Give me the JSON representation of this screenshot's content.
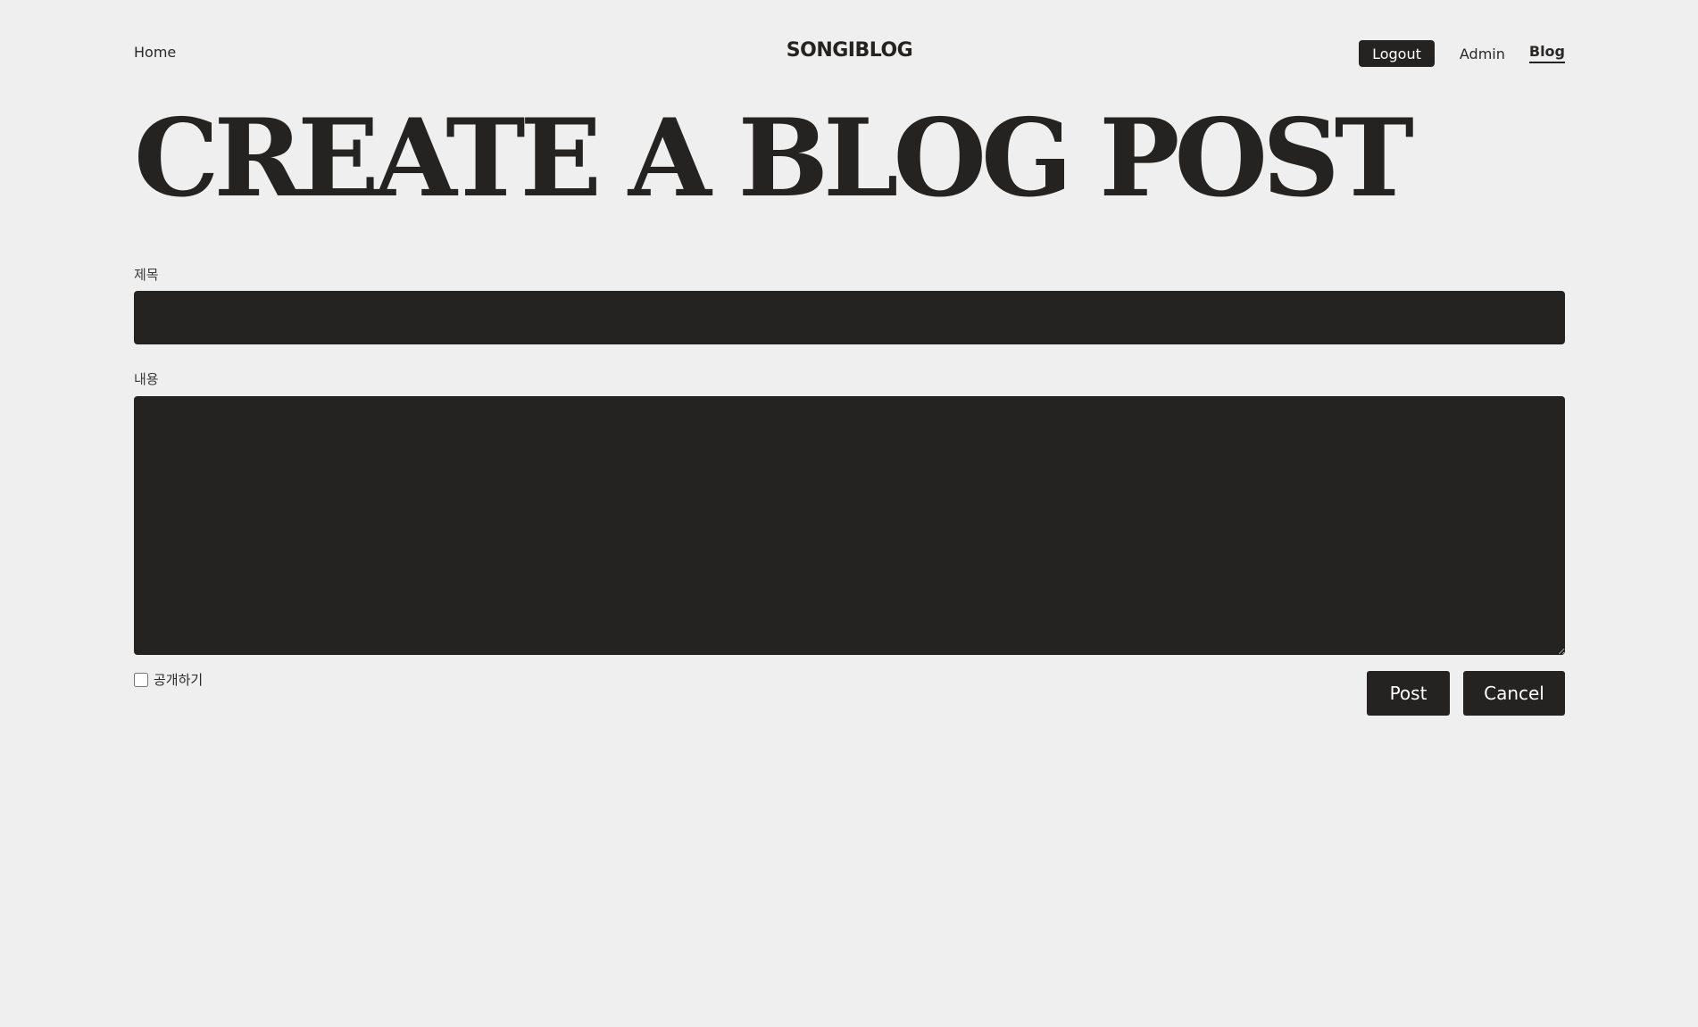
{
  "header": {
    "home_link": "Home",
    "brand": "SONGIBLOG",
    "logout_label": "Logout",
    "admin_link": "Admin",
    "blog_link": "Blog"
  },
  "page": {
    "title": "CREATE A BLOG POST"
  },
  "form": {
    "title_label": "제목",
    "title_value": "",
    "content_label": "내용",
    "content_value": "",
    "public_label": "공개하기",
    "public_checked": false,
    "post_label": "Post",
    "cancel_label": "Cancel"
  },
  "colors": {
    "background": "#efefef",
    "ink": "#242322",
    "button_text": "#ffffff"
  }
}
